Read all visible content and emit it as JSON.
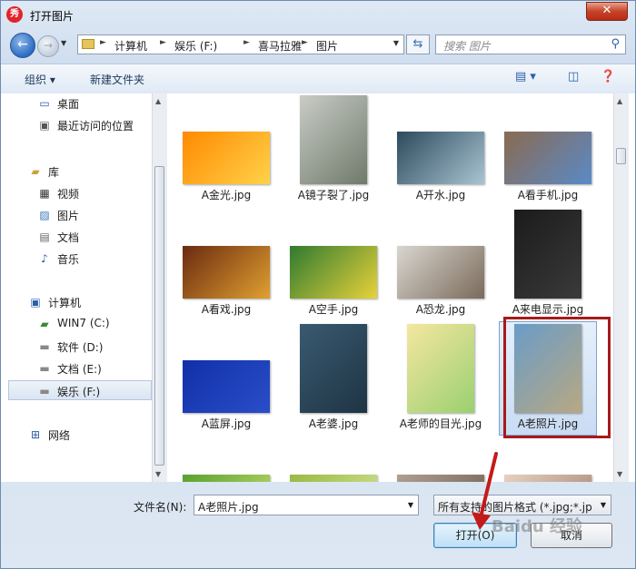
{
  "window": {
    "title": "打开图片",
    "app_icon_text": "秀"
  },
  "nav": {
    "breadcrumb": [
      "计算机",
      "娱乐 (F:)",
      "喜马拉雅",
      "图片"
    ],
    "search_placeholder": "搜索 图片"
  },
  "toolbar": {
    "organize_label": "组织",
    "new_folder_label": "新建文件夹"
  },
  "sidebar": {
    "items": [
      {
        "label": "桌面",
        "icon": "desktop-icon"
      },
      {
        "label": "最近访问的位置",
        "icon": "recent-places-icon"
      },
      {
        "label": "库",
        "icon": "library-icon"
      },
      {
        "label": "视频",
        "icon": "videos-icon"
      },
      {
        "label": "图片",
        "icon": "pictures-icon"
      },
      {
        "label": "文档",
        "icon": "documents-icon"
      },
      {
        "label": "音乐",
        "icon": "music-icon"
      },
      {
        "label": "计算机",
        "icon": "computer-icon"
      },
      {
        "label": "WIN7 (C:)",
        "icon": "windows-drive-icon"
      },
      {
        "label": "软件 (D:)",
        "icon": "drive-icon"
      },
      {
        "label": "文档 (E:)",
        "icon": "drive-icon"
      },
      {
        "label": "娱乐 (F:)",
        "icon": "drive-icon",
        "selected": true
      },
      {
        "label": "网络",
        "icon": "network-icon"
      }
    ]
  },
  "files": [
    {
      "name": "A金光.jpg",
      "colors": [
        "#ff8a00",
        "#ffd24a"
      ]
    },
    {
      "name": "A镜子裂了.jpg",
      "colors": [
        "#c9ccc6",
        "#6f7a6a"
      ]
    },
    {
      "name": "A开水.jpg",
      "colors": [
        "#2c4a5c",
        "#a9c4d2"
      ]
    },
    {
      "name": "A看手机.jpg",
      "colors": [
        "#8a6a50",
        "#5a8ac8"
      ]
    },
    {
      "name": "A看戏.jpg",
      "colors": [
        "#6a2a10",
        "#e0a030"
      ]
    },
    {
      "name": "A空手.jpg",
      "colors": [
        "#2f7a30",
        "#e8d23a"
      ]
    },
    {
      "name": "A恐龙.jpg",
      "colors": [
        "#d9d6d0",
        "#7a6a5a"
      ]
    },
    {
      "name": "A来电显示.jpg",
      "colors": [
        "#1b1b1b",
        "#3a3a3a"
      ]
    },
    {
      "name": "A蓝屏.jpg",
      "colors": [
        "#1030a8",
        "#2a4ec8"
      ]
    },
    {
      "name": "A老婆.jpg",
      "colors": [
        "#3a5a70",
        "#1e3444"
      ]
    },
    {
      "name": "A老师的目光.jpg",
      "colors": [
        "#f5e6a0",
        "#9ad070"
      ]
    },
    {
      "name": "A老照片.jpg",
      "colors": [
        "#6a9cc8",
        "#b8a882"
      ],
      "selected": true
    },
    {
      "name": "",
      "colors": [
        "#5aa030",
        "#c8e070"
      ]
    },
    {
      "name": "",
      "colors": [
        "#9ab840",
        "#d8e8a0"
      ]
    },
    {
      "name": "",
      "colors": [
        "#b0a090",
        "#6a5a4a"
      ]
    },
    {
      "name": "",
      "colors": [
        "#e8d0c0",
        "#a08070"
      ]
    }
  ],
  "bottom": {
    "filename_label": "文件名(N):",
    "filename_value": "A老照片.jpg",
    "filter_value": "所有支持的图片格式 (*.jpg;*.jp",
    "open_label": "打开(O)",
    "cancel_label": "取消"
  },
  "watermark": "Baidu 经验",
  "colors": {
    "highlight_frame": "#a61b1b",
    "annotation_arrow": "#c41a1a"
  }
}
